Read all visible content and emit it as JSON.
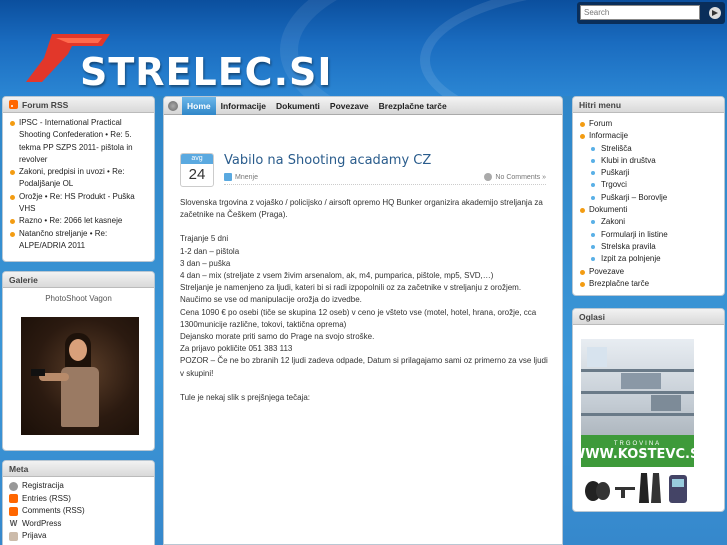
{
  "header": {
    "logo_text": "STRELEC.SI",
    "search_placeholder": "Search"
  },
  "left": {
    "forum_rss": {
      "title": "Forum RSS",
      "items": [
        "IPSC - International Practical Shooting Confederation • Re: 5. tekma PP SZPS 2011- pištola in revolver",
        "Zakoni, predpisi in uvozi • Re: Podaljšanje OL",
        "Orožje • Re: HS Produkt - Puška VHS",
        "Razno • Re: 2066 let kasneje",
        "Natančno streljanje • Re: ALPE/ADRIA 2011"
      ]
    },
    "galerie": {
      "title": "Galerie",
      "caption": "PhotoShoot Vagon"
    },
    "meta": {
      "title": "Meta",
      "items": [
        "Registracija",
        "Entries (RSS)",
        "Comments (RSS)",
        "WordPress",
        "Prijava"
      ]
    }
  },
  "nav": {
    "items": [
      "Home",
      "Informacije",
      "Dokumenti",
      "Povezave",
      "Brezplačne tarče"
    ]
  },
  "post": {
    "month": "avg",
    "day": "24",
    "title": "Vabilo na Shooting acadamy CZ",
    "category": "Mnenje",
    "comments": "No Comments »",
    "paragraphs": [
      "Slovenska trgovina z vojaško / policijsko / airsoft opremo HQ Bunker organizira akademijo streljanja za začetnike na Češkem (Praga).",
      "Trajanje 5 dni\n1-2 dan – pištola\n3 dan – puška\n4 dan – mix (streljate z vsem živim arsenalom, ak, m4, pumparica, pištole, mp5, SVD,…)\nStreljanje je namenjeno za ljudi, kateri bi si radi izpopolnili oz za začetnike v streljanju z orožjem. Naučimo se vse od manipulacije orožja do izvedbe.\nCena 1090 € po osebi (tiče se skupina 12 oseb) v ceno je všteto vse (motel, hotel, hrana, orožje, cca 1300municije različne, tokovi, taktična oprema)\nDejansko morate priti samo do Prage na svojo stroške.\nZa prijavo pokličite 051 383 113\nPOZOR – Če ne bo zbranih 12 ljudi zadeva odpade, Datum si prilagajamo sami oz primerno za vse ljudi v skupini!",
      "Tule je nekaj slik s prejšnjega tečaja:"
    ]
  },
  "right": {
    "menu": {
      "title": "Hitri menu",
      "items": [
        {
          "label": "Forum",
          "level": 0
        },
        {
          "label": "Informacije",
          "level": 0
        },
        {
          "label": "Strelišča",
          "level": 1
        },
        {
          "label": "Klubi in društva",
          "level": 1
        },
        {
          "label": "Puškarji",
          "level": 1
        },
        {
          "label": "Trgovci",
          "level": 1
        },
        {
          "label": "Puškarji – Borovlje",
          "level": 1
        },
        {
          "label": "Dokumenti",
          "level": 0
        },
        {
          "label": "Zakoni",
          "level": 1
        },
        {
          "label": "Formularji in listine",
          "level": 1
        },
        {
          "label": "Strelska pravila",
          "level": 1
        },
        {
          "label": "Izpit za polnjenje",
          "level": 1
        },
        {
          "label": "Povezave",
          "level": 0
        },
        {
          "label": "Brezplačne tarče",
          "level": 0
        }
      ]
    },
    "oglasi": {
      "title": "Oglasi",
      "ad_top": "TRGOVINA",
      "ad_brand": "WWW.KOSTEVC.SI"
    }
  },
  "colors": {
    "accent": "#2f86c8",
    "bullet": "#f39c12",
    "link": "#2a5c8c"
  }
}
